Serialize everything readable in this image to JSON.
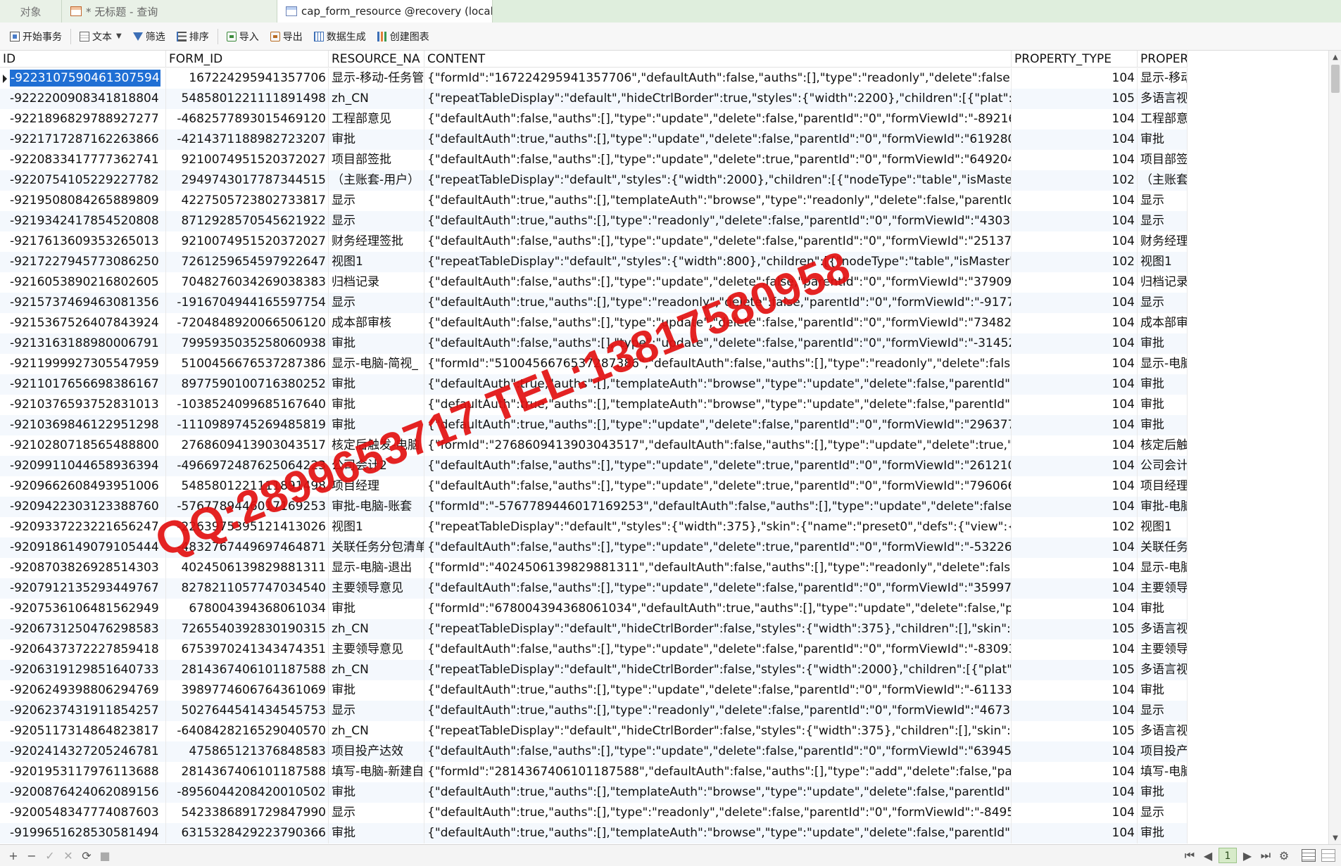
{
  "tabs": [
    {
      "label": "对象"
    },
    {
      "label": "* 无标题 - 查询"
    },
    {
      "label": "cap_form_resource @recovery (local..."
    }
  ],
  "toolbar": {
    "begin_txn": "开始事务",
    "text": "文本",
    "filter": "筛选",
    "sort": "排序",
    "import": "导入",
    "export": "导出",
    "data_gen": "数据生成",
    "create_chart": "创建图表"
  },
  "grid": {
    "columns": [
      "ID",
      "FORM_ID",
      "RESOURCE_NA",
      "CONTENT",
      "PROPERTY_TYPE",
      "PROPER"
    ],
    "rows": [
      [
        "-9223107590461307594",
        "1672242959413577​06",
        "显示-移动-任务管",
        "{\"formId\":\"1672242959413577​06\",\"defaultAuth\":false,\"auths\":[],\"type\":\"readonly\",\"delete\":false,\"",
        "104",
        "显示-移动"
      ],
      [
        "-9222200908341818804",
        "5485801221111891498",
        "zh_CN",
        "{\"repeatTableDisplay\":\"default\",\"hideCtrlBorder\":true,\"styles\":{\"width\":2200},\"children\":[{\"plat\":\"p",
        "105",
        "多语言视"
      ],
      [
        "-9221896829788927277",
        "-4682577893015469120",
        "工程部意见",
        "{\"defaultAuth\":false,\"auths\":[],\"type\":\"update\",\"delete\":false,\"parentId\":\"0\",\"formViewId\":\"-89216",
        "104",
        "工程部意"
      ],
      [
        "-9221717287162263866",
        "-4214371188982723207",
        "审批",
        "{\"defaultAuth\":true,\"auths\":[],\"type\":\"update\",\"delete\":false,\"parentId\":\"0\",\"formViewId\":\"619280",
        "104",
        "审批"
      ],
      [
        "-9220833417777362741",
        "9210074951520372027",
        "项目部签批",
        "{\"defaultAuth\":false,\"auths\":[],\"type\":\"update\",\"delete\":true,\"parentId\":\"0\",\"formViewId\":\"649204",
        "104",
        "项目部签"
      ],
      [
        "-9220754105229227782",
        "2949743017787344515",
        "（主账套-用户）",
        "{\"repeatTableDisplay\":\"default\",\"styles\":{\"width\":2000},\"children\":[{\"nodeType\":\"table\",\"isMaster\"",
        "102",
        "（主账套"
      ],
      [
        "-9219508084265889809",
        "4227505723802733817",
        "显示",
        "{\"defaultAuth\":true,\"auths\":[],\"templateAuth\":\"browse\",\"type\":\"readonly\",\"delete\":false,\"parentId",
        "104",
        "显示"
      ],
      [
        "-9219342417854520808",
        "8712928570545621922",
        "显示",
        "{\"defaultAuth\":true,\"auths\":[],\"type\":\"readonly\",\"delete\":false,\"parentId\":\"0\",\"formViewId\":\"43030",
        "104",
        "显示"
      ],
      [
        "-9217613609353265013",
        "9210074951520372027",
        "财务经理签批",
        "{\"defaultAuth\":false,\"auths\":[],\"type\":\"update\",\"delete\":false,\"parentId\":\"0\",\"formViewId\":\"251370",
        "104",
        "财务经理"
      ],
      [
        "-9217227945773086250",
        "7261259654597922647",
        "视图1",
        "{\"repeatTableDisplay\":\"default\",\"styles\":{\"width\":800},\"children\":[{\"nodeType\":\"table\",\"isMaster\":t",
        "102",
        "视图1"
      ],
      [
        "-9216053890216802605",
        "7048276034269038383",
        "归档记录",
        "{\"defaultAuth\":false,\"auths\":[],\"type\":\"update\",\"delete\":false,\"parentId\":\"0\",\"formViewId\":\"379097",
        "104",
        "归档记录"
      ],
      [
        "-9215737469463081356",
        "-1916704944165597754",
        "显示",
        "{\"defaultAuth\":true,\"auths\":[],\"type\":\"readonly\",\"delete\":false,\"parentId\":\"0\",\"formViewId\":\"-9177",
        "104",
        "显示"
      ],
      [
        "-9215367526407843924",
        "-7204848920066506120",
        "成本部审核",
        "{\"defaultAuth\":false,\"auths\":[],\"type\":\"update\",\"delete\":false,\"parentId\":\"0\",\"formViewId\":\"734820",
        "104",
        "成本部审"
      ],
      [
        "-9213163188980006791",
        "7995935035258060938",
        "审批",
        "{\"defaultAuth\":false,\"auths\":[],\"type\":\"update\",\"delete\":false,\"parentId\":\"0\",\"formViewId\":\"-31452",
        "104",
        "审批"
      ],
      [
        "-9211999927305547959",
        "5100456676537287386",
        "显示-电脑-简视_",
        "{\"formId\":\"5100456676537287386\",\"defaultAuth\":false,\"auths\":[],\"type\":\"readonly\",\"delete\":false",
        "104",
        "显示-电脑"
      ],
      [
        "-9211017656698386167",
        "8977590100716380252",
        "审批",
        "{\"defaultAuth\":true,\"auths\":[],\"templateAuth\":\"browse\",\"type\":\"update\",\"delete\":false,\"parentId\":",
        "104",
        "审批"
      ],
      [
        "-9210376593752831013",
        "-1038524099685167640",
        "审批",
        "{\"defaultAuth\":true,\"auths\":[],\"templateAuth\":\"browse\",\"type\":\"update\",\"delete\":false,\"parentId\":",
        "104",
        "审批"
      ],
      [
        "-9210369846122951298",
        "-1110989745269485819",
        "审批",
        "{\"defaultAuth\":true,\"auths\":[],\"type\":\"update\",\"delete\":false,\"parentId\":\"0\",\"formViewId\":\"296377",
        "104",
        "审批"
      ],
      [
        "-9210280718565488800",
        "2768609413903043517",
        "核定后触发-电脑",
        "{\"formId\":\"2768609413903043517\",\"defaultAuth\":false,\"auths\":[],\"type\":\"update\",\"delete\":true,\"p",
        "104",
        "核定后触"
      ],
      [
        "-9209911044658936394",
        "-4966972487625064223",
        "公司会计2",
        "{\"defaultAuth\":false,\"auths\":[],\"type\":\"update\",\"delete\":true,\"parentId\":\"0\",\"formViewId\":\"261210",
        "104",
        "公司会计"
      ],
      [
        "-9209662608493951006",
        "5485801221111891498",
        "项目经理",
        "{\"defaultAuth\":false,\"auths\":[],\"type\":\"update\",\"delete\":true,\"parentId\":\"0\",\"formViewId\":\"796066",
        "104",
        "项目经理"
      ],
      [
        "-9209422303123388760",
        "-5767789446017169253",
        "审批-电脑-账套",
        "{\"formId\":\"-5767789446017169253\",\"defaultAuth\":false,\"auths\":[],\"type\":\"update\",\"delete\":false,",
        "104",
        "审批-电脑"
      ],
      [
        "-9209337223221656247",
        "-2263975395121413026",
        "视图1",
        "{\"repeatTableDisplay\":\"default\",\"styles\":{\"width\":375},\"skin\":{\"name\":\"preset0\",\"defs\":{\"view\":{\"bg",
        "102",
        "视图1"
      ],
      [
        "-9209186149079105444",
        "-4832767449697464871",
        "关联任务分包清单",
        "{\"defaultAuth\":false,\"auths\":[],\"type\":\"update\",\"delete\":true,\"parentId\":\"0\",\"formViewId\":\"-53226",
        "104",
        "关联任务"
      ],
      [
        "-9208703826928514303",
        "4024506139829881311",
        "显示-电脑-退出",
        "{\"formId\":\"4024506139829881311\",\"defaultAuth\":false,\"auths\":[],\"type\":\"readonly\",\"delete\":false",
        "104",
        "显示-电脑"
      ],
      [
        "-9207912135293449767",
        "8278211057747034540",
        "主要领导意见",
        "{\"defaultAuth\":false,\"auths\":[],\"type\":\"update\",\"delete\":false,\"parentId\":\"0\",\"formViewId\":\"359978",
        "104",
        "主要领导"
      ],
      [
        "-9207536106481562949",
        "6780043943680610​34",
        "审批",
        "{\"formId\":\"678004394368061034\",\"defaultAuth\":true,\"auths\":[],\"type\":\"update\",\"delete\":false,\"pa",
        "104",
        "审批"
      ],
      [
        "-9206731250476298583",
        "7265540392830190315",
        "zh_CN",
        "{\"repeatTableDisplay\":\"default\",\"hideCtrlBorder\":false,\"styles\":{\"width\":375},\"children\":[],\"skin\":{\"",
        "105",
        "多语言视"
      ],
      [
        "-9206437372227859418",
        "6753970241343474351",
        "主要领导意见",
        "{\"defaultAuth\":false,\"auths\":[],\"type\":\"update\",\"delete\":false,\"parentId\":\"0\",\"formViewId\":\"-83093",
        "104",
        "主要领导"
      ],
      [
        "-9206319129851640733",
        "2814367406101187588",
        "zh_CN",
        "{\"repeatTableDisplay\":\"default\",\"hideCtrlBorder\":false,\"styles\":{\"width\":2000},\"children\":[{\"plat\":\"p",
        "105",
        "多语言视"
      ],
      [
        "-9206249398806294769",
        "3989774606764361069",
        "审批",
        "{\"defaultAuth\":true,\"auths\":[],\"type\":\"update\",\"delete\":false,\"parentId\":\"0\",\"formViewId\":\"-611332",
        "104",
        "审批"
      ],
      [
        "-9206237431911854257",
        "5027644541434545753",
        "显示",
        "{\"defaultAuth\":true,\"auths\":[],\"type\":\"readonly\",\"delete\":false,\"parentId\":\"0\",\"formViewId\":\"46732",
        "104",
        "显示"
      ],
      [
        "-9205117314864823817",
        "-6408428216529040570",
        "zh_CN",
        "{\"repeatTableDisplay\":\"default\",\"hideCtrlBorder\":false,\"styles\":{\"width\":375},\"children\":[],\"skin\":{\"",
        "105",
        "多语言视"
      ],
      [
        "-9202414327205246781",
        "475865121376848583",
        "项目投产达效",
        "{\"defaultAuth\":false,\"auths\":[],\"type\":\"update\",\"delete\":false,\"parentId\":\"0\",\"formViewId\":\"639454",
        "104",
        "项目投产"
      ],
      [
        "-9201953117976113688",
        "2814367406101187588",
        "填写-电脑-新建自",
        "{\"formId\":\"2814367406101187588\",\"defaultAuth\":false,\"auths\":[],\"type\":\"add\",\"delete\":false,\"par",
        "104",
        "填写-电脑"
      ],
      [
        "-9200876424062089156",
        "-8956044208420010502",
        "审批",
        "{\"defaultAuth\":true,\"auths\":[],\"templateAuth\":\"browse\",\"type\":\"update\",\"delete\":false,\"parentId\":",
        "104",
        "审批"
      ],
      [
        "-9200548347774087603",
        "5423386891729847990",
        "显示",
        "{\"defaultAuth\":true,\"auths\":[],\"type\":\"readonly\",\"delete\":false,\"parentId\":\"0\",\"formViewId\":\"-8495",
        "104",
        "显示"
      ],
      [
        "-9199651628530581494",
        "6315328429223790366",
        "审批",
        "{\"defaultAuth\":true,\"auths\":[],\"templateAuth\":\"browse\",\"type\":\"update\",\"delete\":false,\"parentId\":",
        "104",
        "审批"
      ]
    ]
  },
  "watermark": "QQ:2899653717 TEL:13817580958",
  "statusbar": {
    "add": "+",
    "delete": "−",
    "apply": "✓",
    "discard": "✕",
    "refresh": "⟳",
    "stop": "■",
    "first": "⏮",
    "prev": "◀",
    "page": "1",
    "next": "▶",
    "last": "⏭",
    "settings": "⚙"
  },
  "icons": {
    "grid_view": "grid-view-icon",
    "form_view": "form-view-icon"
  }
}
